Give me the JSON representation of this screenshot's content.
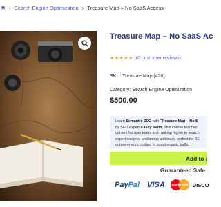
{
  "breadcrumb": {
    "home_icon": "home-icon",
    "separator": "›",
    "category": "Search Engine Optimization",
    "current": "Treasure Map – No SaaS Access"
  },
  "product": {
    "title": "Treasure Map – No SaaS Ac",
    "rating": {
      "stars": "★★★★★",
      "rating_value": 5,
      "reviews": "(0 customer reviews)"
    },
    "sku": "SKU: Treasure Map (420)",
    "category": "Category: Search Engine Optimization",
    "price": "$500.00",
    "description": {
      "line1_a": "Learn ",
      "line1_b": "Semantic SEO",
      "line1_c": " with “",
      "line1_d": "Treasure Map – No S",
      "line2_a": "by SEO expert ",
      "line2_b": "Casey Keith",
      "line2_c": ". This course teaches",
      "line3": "content for user intent and ranking higher in search",
      "line4": "expert insights, and bonus webinars, perfect for SE",
      "line5": "entrepreneurs looking to boost organic traffic."
    },
    "image_alt": "Treasure map with vintage cameras, notebook and pencil"
  },
  "cart": {
    "label": "Add to ca"
  },
  "guarantee": {
    "label": "Guaranteed Safe"
  },
  "payments": {
    "paypal_a": "Pay",
    "paypal_b": "Pal",
    "visa": "VISA",
    "mastercard": "mastercard",
    "discover": "DISCO"
  },
  "colors": {
    "link": "#4e5bd8",
    "title": "#2b3a8c",
    "star": "#f2a82e",
    "cart_button": "#c9f24a",
    "description_bg": "#eef2fb"
  }
}
